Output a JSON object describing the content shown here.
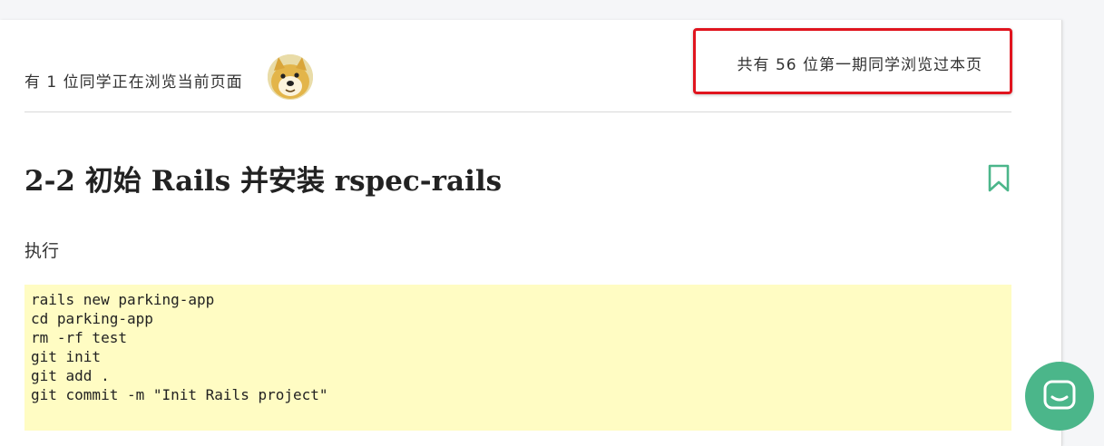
{
  "presence": {
    "online_text": "有 1 位同学正在浏览当前页面",
    "total_text": "共有 56 位第一期同学浏览过本页",
    "highlight_color": "#e0141e"
  },
  "article": {
    "title": "2-2 初始 Rails 并安装 rspec-rails",
    "paragraph": "执行",
    "code_lines": [
      "rails new parking-app",
      "cd parking-app",
      "rm -rf test",
      "git init",
      "git add .",
      "git commit -m \"Init Rails project\""
    ],
    "code_background": "#fffcc3"
  },
  "icons": {
    "bookmark": "bookmark-icon",
    "chat": "chat-icon",
    "avatar": "doge-avatar"
  },
  "colors": {
    "accent_green": "#4bb68a"
  }
}
